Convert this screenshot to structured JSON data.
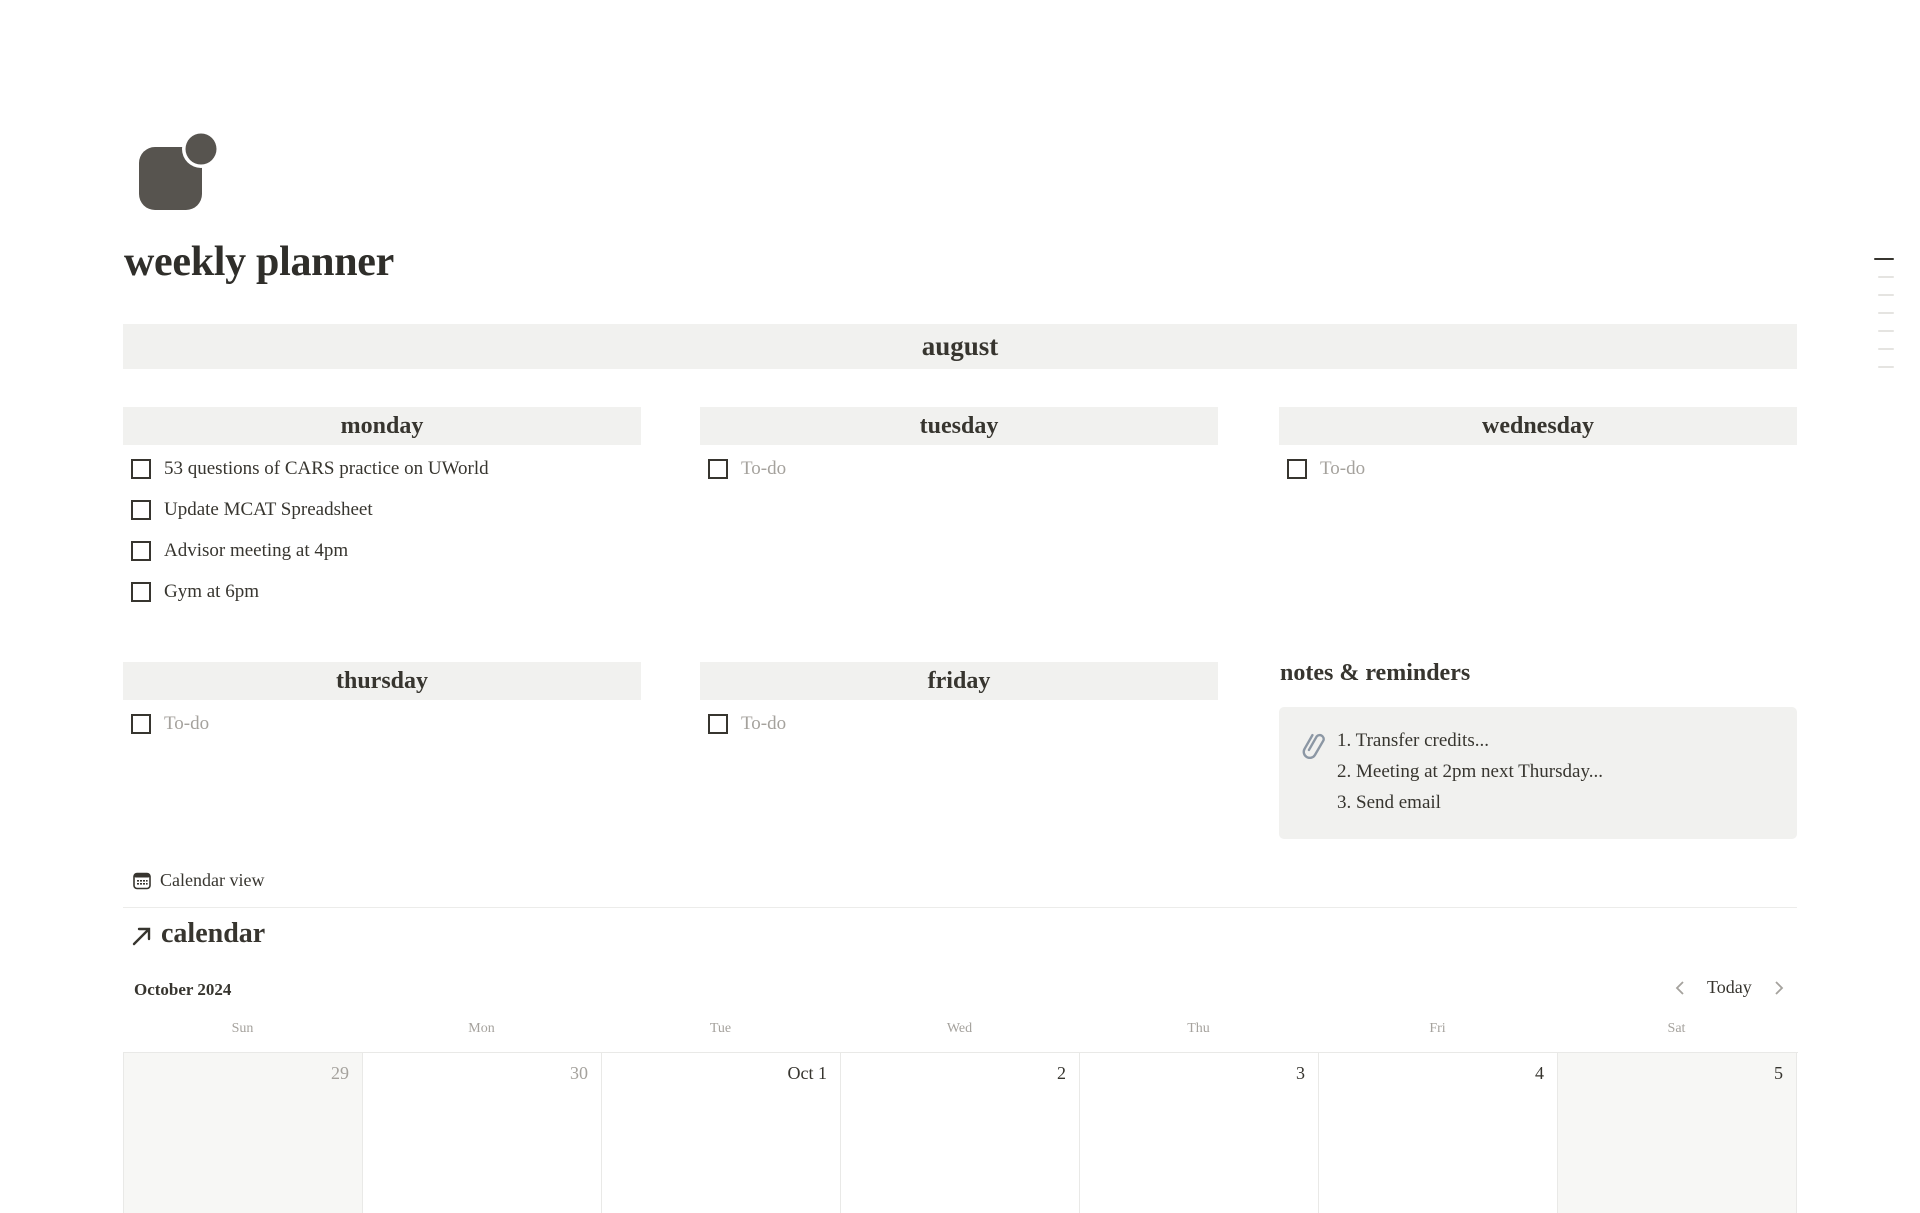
{
  "page": {
    "icon": "rounded-square-with-dot-icon",
    "title": "weekly planner"
  },
  "month_band": {
    "label": "august"
  },
  "days": [
    {
      "key": "monday",
      "label": "monday",
      "todos": [
        {
          "text": "53 questions of CARS practice on UWorld",
          "checked": false
        },
        {
          "text": "Update MCAT Spreadsheet",
          "checked": false
        },
        {
          "text": "Advisor meeting at 4pm",
          "checked": false
        },
        {
          "text": "Gym at 6pm",
          "checked": false
        }
      ]
    },
    {
      "key": "tuesday",
      "label": "tuesday",
      "placeholder": "To-do"
    },
    {
      "key": "wednesday",
      "label": "wednesday",
      "placeholder": "To-do"
    },
    {
      "key": "thursday",
      "label": "thursday",
      "placeholder": "To-do"
    },
    {
      "key": "friday",
      "label": "friday",
      "placeholder": "To-do"
    }
  ],
  "notes": {
    "title": "notes & reminders",
    "icon": "paperclip-icon",
    "items": [
      "1. Transfer credits...",
      "2. Meeting at 2pm next Thursday...",
      "3. Send email"
    ]
  },
  "calendar_view": {
    "tab_label": "Calendar view",
    "tab_icon": "calendar-icon",
    "title": "calendar",
    "title_icon": "arrow-up-right-icon",
    "month_label": "October 2024",
    "today_label": "Today",
    "weekdays": [
      "Sun",
      "Mon",
      "Tue",
      "Wed",
      "Thu",
      "Fri",
      "Sat"
    ],
    "first_week": [
      {
        "label": "29",
        "other_month": true,
        "weekend": true
      },
      {
        "label": "30",
        "other_month": true,
        "weekend": false
      },
      {
        "label": "Oct 1",
        "other_month": false,
        "weekend": false
      },
      {
        "label": "2",
        "other_month": false,
        "weekend": false
      },
      {
        "label": "3",
        "other_month": false,
        "weekend": false
      },
      {
        "label": "4",
        "other_month": false,
        "weekend": false
      },
      {
        "label": "5",
        "other_month": false,
        "weekend": true
      }
    ]
  },
  "toc": {
    "entries": 7,
    "active_index": 0
  },
  "colors": {
    "text": "#37352f",
    "muted": "#a5a29d",
    "band_bg": "#f1f1ef",
    "weekend_bg": "#f7f7f5",
    "icon": "#57544f"
  }
}
